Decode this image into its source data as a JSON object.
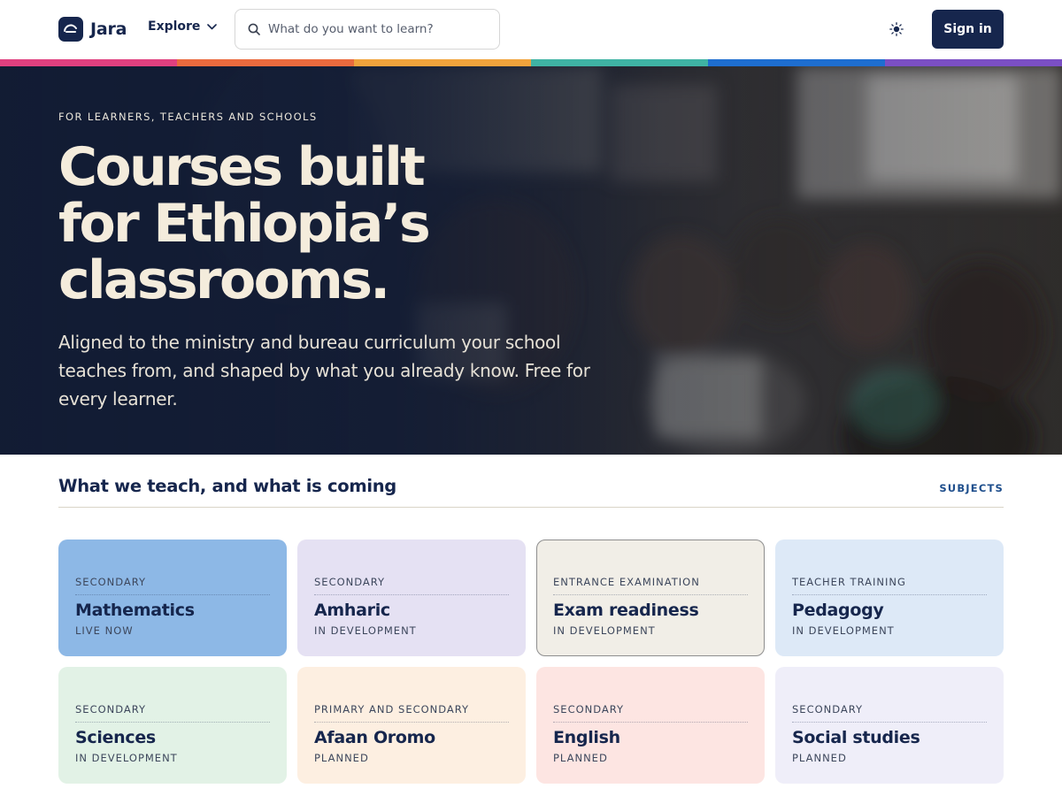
{
  "header": {
    "brand": "Jara",
    "explore_label": "Explore",
    "search_placeholder": "What do you want to learn?",
    "signin_label": "Sign in"
  },
  "stripe_colors": [
    "#e0407f",
    "#ea6a3e",
    "#f0a33c",
    "#3fb3a4",
    "#1e6ed0",
    "#7b4fc4"
  ],
  "hero": {
    "eyebrow": "FOR LEARNERS, TEACHERS AND SCHOOLS",
    "title_line1": "Courses built",
    "title_line2": "for Ethiopia’s",
    "title_line3": "classrooms.",
    "subtitle": "Aligned to the ministry and bureau curriculum your school teaches from, and shaped by what you already know. Free for every learner."
  },
  "section": {
    "title": "What we teach, and what is coming",
    "link_label": "SUBJECTS"
  },
  "subjects": [
    {
      "category": "SECONDARY",
      "name": "Mathematics",
      "status": "LIVE NOW",
      "bg": "#8db8e6"
    },
    {
      "category": "SECONDARY",
      "name": "Amharic",
      "status": "IN DEVELOPMENT",
      "bg": "#e5e1f3"
    },
    {
      "category": "ENTRANCE EXAMINATION",
      "name": "Exam readiness",
      "status": "IN DEVELOPMENT",
      "bg": "#f1eee7"
    },
    {
      "category": "TEACHER TRAINING",
      "name": "Pedagogy",
      "status": "IN DEVELOPMENT",
      "bg": "#dde9f7"
    },
    {
      "category": "SECONDARY",
      "name": "Sciences",
      "status": "IN DEVELOPMENT",
      "bg": "#e2f2e6"
    },
    {
      "category": "PRIMARY AND SECONDARY",
      "name": "Afaan Oromo",
      "status": "PLANNED",
      "bg": "#fdefe1"
    },
    {
      "category": "SECONDARY",
      "name": "English",
      "status": "PLANNED",
      "bg": "#fde5e2"
    },
    {
      "category": "SECONDARY",
      "name": "Social studies",
      "status": "PLANNED",
      "bg": "#efeef9"
    }
  ]
}
